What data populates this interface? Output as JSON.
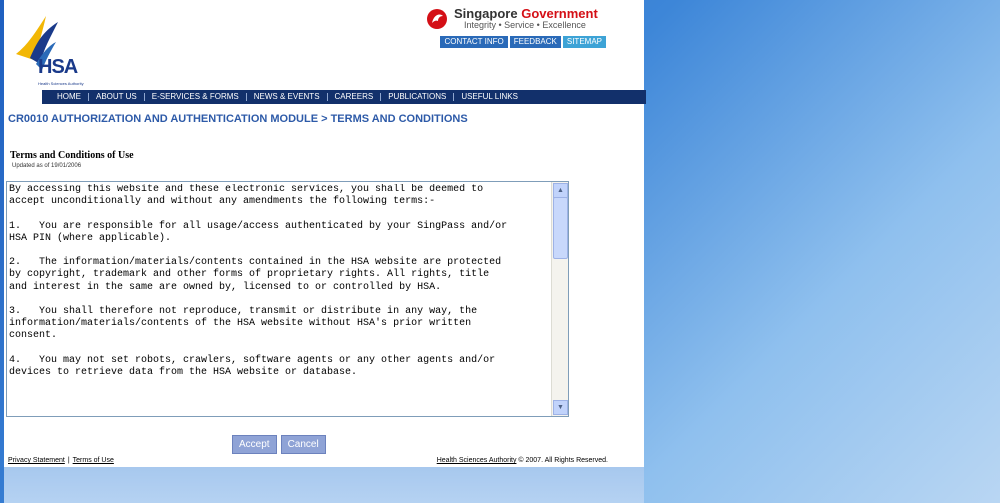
{
  "header": {
    "logo_text": "HSA",
    "logo_sub": "Health Sciences Authority",
    "gov_title_part1": "Singapore",
    "gov_title_part2": "Government",
    "gov_tagline": "Integrity • Service • Excellence",
    "top_links": [
      "CONTACT INFO",
      "FEEDBACK",
      "SITEMAP"
    ]
  },
  "nav": {
    "items": [
      "HOME",
      "ABOUT US",
      "E-SERVICES & FORMS",
      "NEWS & EVENTS",
      "CAREERS",
      "PUBLICATIONS",
      "USEFUL LINKS"
    ]
  },
  "breadcrumb": "CR0010 AUTHORIZATION AND AUTHENTICATION MODULE > TERMS AND CONDITIONS",
  "terms": {
    "title": "Terms and Conditions of Use",
    "updated": "Updated as of 19/01/2006",
    "body": "By accessing this website and these electronic services, you shall be deemed to\naccept unconditionally and without any amendments the following terms:-\n\n1.   You are responsible for all usage/access authenticated by your SingPass and/or\nHSA PIN (where applicable).\n\n2.   The information/materials/contents contained in the HSA website are protected\nby copyright, trademark and other forms of proprietary rights. All rights, title\nand interest in the same are owned by, licensed to or controlled by HSA.\n\n3.   You shall therefore not reproduce, transmit or distribute in any way, the\ninformation/materials/contents of the HSA website without HSA's prior written\nconsent.\n\n4.   You may not set robots, crawlers, software agents or any other agents and/or\ndevices to retrieve data from the HSA website or database."
  },
  "buttons": {
    "accept": "Accept",
    "cancel": "Cancel"
  },
  "footer": {
    "privacy": "Privacy Statement",
    "terms": "Terms of Use",
    "copyright_link": "Health Sciences Authority",
    "copyright_rest": " © 2007. All Rights Reserved."
  },
  "colors": {
    "nav_bg": "#12306b",
    "breadcrumb": "#2d5aa8",
    "button": "#8fa3d6",
    "gov_red": "#d40f16"
  }
}
